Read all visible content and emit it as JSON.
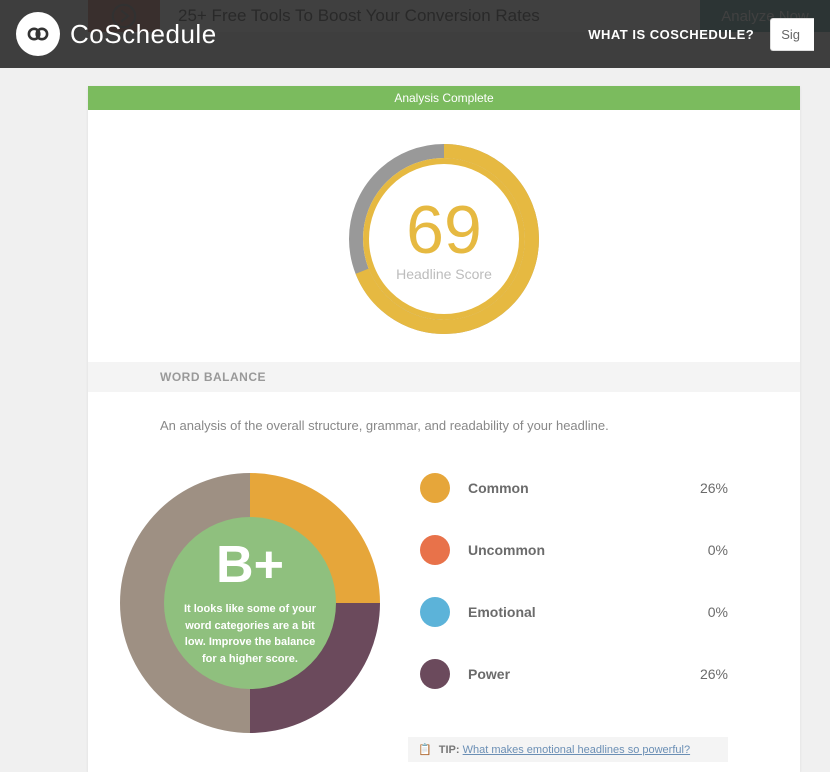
{
  "header": {
    "brand": "CoSchedule",
    "nav_link": "WHAT IS COSCHEDULE?",
    "sign_label": "Sig"
  },
  "input": {
    "headline_value": "25+ Free Tools To Boost Your Conversion Rates",
    "analyze_label": "Analyze Now"
  },
  "banner": {
    "status": "Analysis Complete"
  },
  "score": {
    "value": "69",
    "label": "Headline Score",
    "percent": 69
  },
  "word_balance": {
    "title": "WORD BALANCE",
    "description": "An analysis of the overall structure, grammar, and readability of your headline.",
    "grade": "B+",
    "message": "It looks like some of your word categories are a bit low. Improve the balance for a higher score.",
    "items": [
      {
        "label": "Common",
        "value": "26%",
        "color": "#e6a63a"
      },
      {
        "label": "Uncommon",
        "value": "0%",
        "color": "#e8724a"
      },
      {
        "label": "Emotional",
        "value": "0%",
        "color": "#5cb3d9"
      },
      {
        "label": "Power",
        "value": "26%",
        "color": "#6b4a5c"
      }
    ],
    "tip": {
      "label": "TIP:",
      "link_text": "What makes emotional headlines so powerful?"
    }
  },
  "chart_data": [
    {
      "type": "pie",
      "title": "Headline Score",
      "values": [
        69,
        31
      ],
      "categories": [
        "score",
        "remainder"
      ],
      "colors": [
        "#e6b941",
        "#999999"
      ]
    },
    {
      "type": "pie",
      "title": "Word Balance",
      "categories": [
        "Common",
        "Power",
        "Other"
      ],
      "values": [
        26,
        26,
        48
      ],
      "colors": [
        "#e6a63a",
        "#6b4a5c",
        "#9e9083"
      ],
      "annotations": [
        "B+"
      ]
    }
  ]
}
